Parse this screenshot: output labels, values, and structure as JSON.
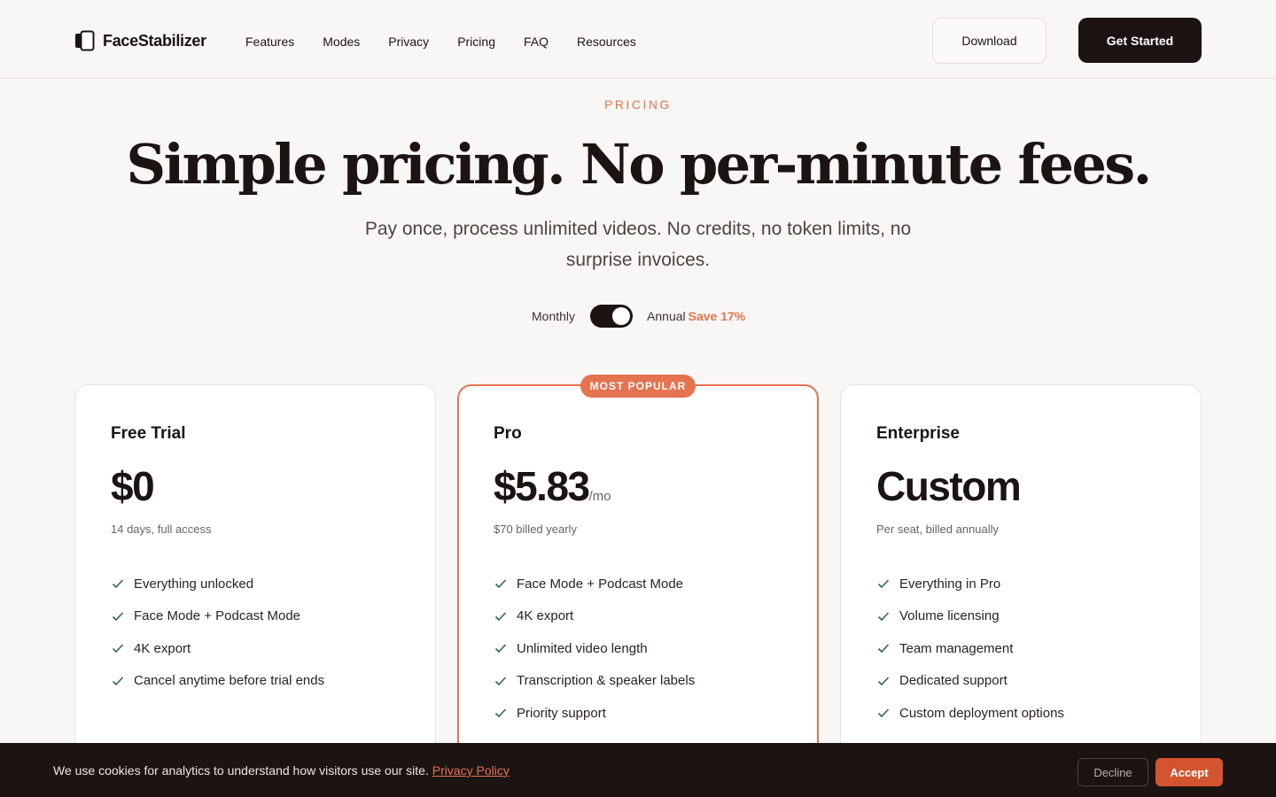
{
  "header": {
    "logo_text": "FaceStabilizer",
    "nav": [
      "Features",
      "Modes",
      "Privacy",
      "Pricing",
      "FAQ",
      "Resources"
    ],
    "download_label": "Download",
    "get_started_label": "Get Started"
  },
  "hero": {
    "eyebrow": "PRICING",
    "headline": "Simple pricing. No per-minute fees.",
    "subhead": "Pay once, process unlimited videos. No credits, no token limits, no surprise invoices."
  },
  "billing": {
    "monthly_label": "Monthly",
    "annual_label": "Annual",
    "save_label": "Save 17%",
    "annual_selected": true
  },
  "plans": [
    {
      "name": "Free Trial",
      "price": "$0",
      "per": "",
      "note": "14 days, full access",
      "features": [
        "Everything unlocked",
        "Face Mode + Podcast Mode",
        "4K export",
        "Cancel anytime before trial ends"
      ]
    },
    {
      "name": "Pro",
      "badge": "MOST POPULAR",
      "price": "$5.83",
      "per": "/mo",
      "note": "$70 billed yearly",
      "features": [
        "Face Mode + Podcast Mode",
        "4K export",
        "Unlimited video length",
        "Transcription & speaker labels",
        "Priority support"
      ]
    },
    {
      "name": "Enterprise",
      "price": "Custom",
      "per": "",
      "note": "Per seat, billed annually",
      "features": [
        "Everything in Pro",
        "Volume licensing",
        "Team management",
        "Dedicated support",
        "Custom deployment options"
      ]
    }
  ],
  "cookie": {
    "text": "We use cookies for analytics to understand how visitors use our site.",
    "link": "Privacy Policy",
    "decline_label": "Decline",
    "accept_label": "Accept"
  },
  "colors": {
    "accent": "#e5734f",
    "dark": "#1c1412",
    "accept": "#d4542f",
    "check": "#2f6b3a"
  }
}
